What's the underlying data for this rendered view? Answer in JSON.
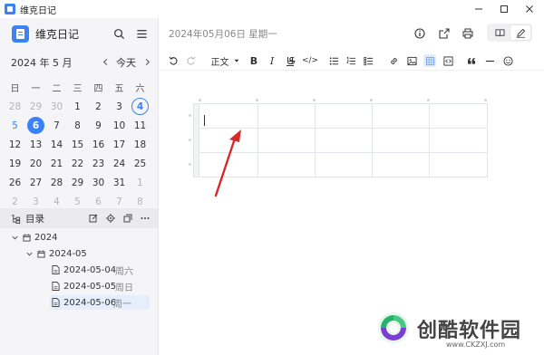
{
  "window": {
    "title": "维克日记"
  },
  "sidebar": {
    "app_name": "维克日记",
    "calendar": {
      "month_label": "2024 年 5 月",
      "today_label": "今天",
      "weekdays": [
        "日",
        "一",
        "二",
        "三",
        "四",
        "五",
        "六"
      ],
      "days": [
        {
          "d": "28",
          "t": "out"
        },
        {
          "d": "29",
          "t": "out"
        },
        {
          "d": "30",
          "t": "out"
        },
        {
          "d": "1",
          "t": ""
        },
        {
          "d": "2",
          "t": ""
        },
        {
          "d": "3",
          "t": ""
        },
        {
          "d": "4",
          "t": "mark"
        },
        {
          "d": "5",
          "t": "sun"
        },
        {
          "d": "6",
          "t": "sel"
        },
        {
          "d": "7",
          "t": ""
        },
        {
          "d": "8",
          "t": ""
        },
        {
          "d": "9",
          "t": ""
        },
        {
          "d": "10",
          "t": ""
        },
        {
          "d": "11",
          "t": ""
        },
        {
          "d": "12",
          "t": ""
        },
        {
          "d": "13",
          "t": ""
        },
        {
          "d": "14",
          "t": ""
        },
        {
          "d": "15",
          "t": ""
        },
        {
          "d": "16",
          "t": ""
        },
        {
          "d": "17",
          "t": ""
        },
        {
          "d": "18",
          "t": ""
        },
        {
          "d": "19",
          "t": ""
        },
        {
          "d": "20",
          "t": ""
        },
        {
          "d": "21",
          "t": ""
        },
        {
          "d": "22",
          "t": ""
        },
        {
          "d": "23",
          "t": ""
        },
        {
          "d": "24",
          "t": ""
        },
        {
          "d": "25",
          "t": ""
        },
        {
          "d": "26",
          "t": ""
        },
        {
          "d": "27",
          "t": ""
        },
        {
          "d": "28",
          "t": ""
        },
        {
          "d": "29",
          "t": ""
        },
        {
          "d": "30",
          "t": ""
        },
        {
          "d": "31",
          "t": ""
        },
        {
          "d": "1",
          "t": "out"
        },
        {
          "d": "2",
          "t": "out"
        },
        {
          "d": "3",
          "t": "out"
        },
        {
          "d": "4",
          "t": "out"
        },
        {
          "d": "5",
          "t": "out"
        },
        {
          "d": "6",
          "t": "out"
        },
        {
          "d": "7",
          "t": "out"
        },
        {
          "d": "8",
          "t": "out"
        }
      ]
    },
    "toc": {
      "label": "目录",
      "year": "2024",
      "month": "2024-05",
      "entries": [
        {
          "date": "2024-05-04",
          "weekday": "周六"
        },
        {
          "date": "2024-05-05",
          "weekday": "周日"
        },
        {
          "date": "2024-05-06",
          "weekday": "周一"
        }
      ]
    }
  },
  "main": {
    "date_title": "2024年05月06日 星期一",
    "toolbar": {
      "paragraph_style": "正文",
      "bold": "B",
      "italic": "I",
      "underline": "U",
      "strike": "S",
      "code": "</>"
    }
  },
  "watermark": {
    "name": "创酷软件园",
    "url": "www.CKZXJ.com"
  },
  "colors": {
    "accent": "#3b82f6",
    "arrow": "#d62a2a"
  }
}
